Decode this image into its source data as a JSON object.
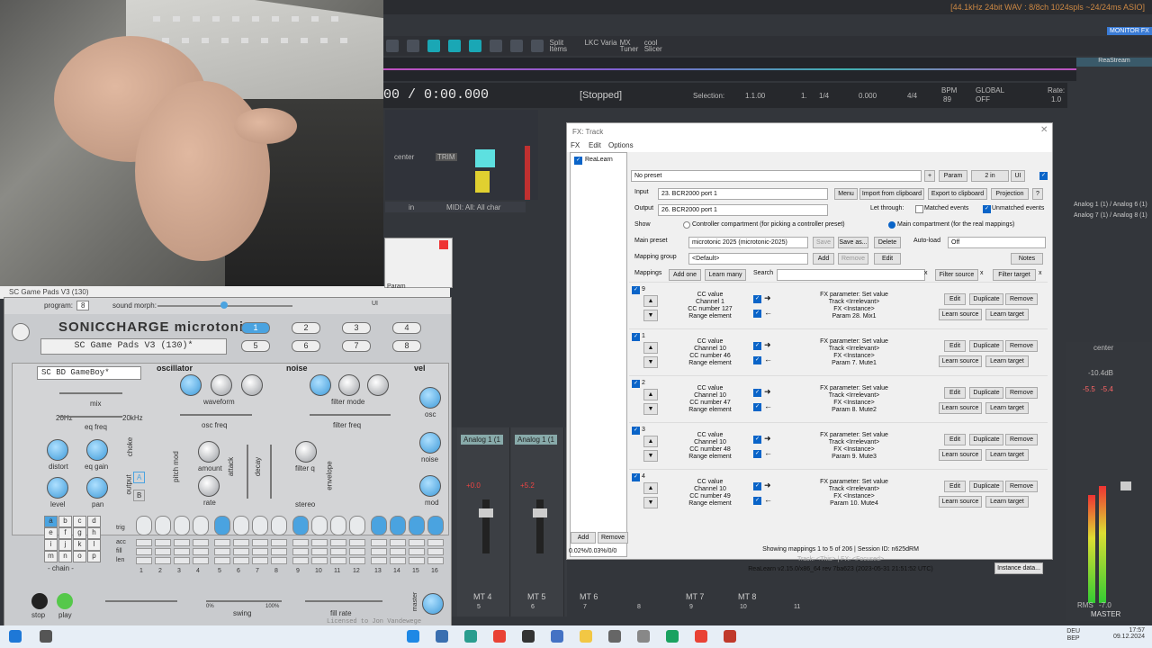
{
  "reaper": {
    "format_info": "[44.1kHz 24bit WAV : 8/8ch 1024spls ~24/24ms ASIO]",
    "monitor": "MONITOR FX",
    "toolbar": {
      "split_items": "Split Items",
      "lkc_varia": "LKC Varia",
      "mx_tuner": "MX Tuner",
      "cool_slicer": "cool Slicer",
      "mx_tuner2": "MX Tuner",
      "cool_slicer2": "cool Slicer"
    },
    "time": "00 / 0:00.000",
    "status": "[Stopped]",
    "selection_label": "Selection:",
    "selection_start": "1.1.00",
    "selection_end": "1.",
    "time_sig1": "1/4",
    "selection_len": "0.000",
    "time_sig2": "4/4",
    "bpm_label": "BPM",
    "bpm": "89",
    "global": "GLOBAL",
    "off": "OFF",
    "rate_label": "Rate:",
    "rate": "1.0",
    "reastream": "ReaStream",
    "track_center": "center",
    "trim": "TRIM",
    "midi_label": "MIDI: All: All char",
    "in": "in",
    "analog_out": [
      "Analog 1 (1) / Analog 6 (1)",
      "Analog 7 (1) / Analog 8 (1)"
    ],
    "strips": [
      {
        "name": "Analog 1 (1",
        "db": "+0.0"
      },
      {
        "name": "Analog 1 (1",
        "db": "+5.2"
      }
    ],
    "master": {
      "label": "MASTER",
      "center": "center",
      "db": "-10.4dB",
      "peak_l": "-5.5",
      "peak_r": "-5.4",
      "rms": "RMS",
      "rms_val": "-7.0"
    },
    "track_labels": [
      "MT 4",
      "MT 5",
      "MT 6",
      "MT 7",
      "MT 8"
    ],
    "track_numbers": [
      "5",
      "6",
      "7",
      "8",
      "9",
      "10",
      "11"
    ]
  },
  "microtonic": {
    "header_preset": "SC Game Pads V3 (130)",
    "program_label": "program:",
    "program_value": "8",
    "sound_morph": "sound morph:",
    "param": "Param",
    "io": "1 out",
    "ui": "UI",
    "brand": "SONICCHARGE microtonic",
    "preset": "SC Game Pads V3 (130)*",
    "patterns": [
      "1",
      "2",
      "3",
      "4",
      "5",
      "6",
      "7",
      "8"
    ],
    "drum_name": "SC BD GameBoy*",
    "sections": {
      "osc": "oscillator",
      "noise": "noise",
      "vel": "vel"
    },
    "labels": {
      "mix": "mix",
      "eq_freq": "eq freq",
      "distort": "distort",
      "eq_gain": "eq gain",
      "level": "level",
      "pan": "pan",
      "waveform": "waveform",
      "osc_freq": "osc freq",
      "pitch_mod": "pitch mod",
      "amount": "amount",
      "rate": "rate",
      "attack": "attack",
      "decay": "decay",
      "filter_mode": "filter mode",
      "filter_freq": "filter freq",
      "filter_q": "filter q",
      "stereo": "stereo",
      "envelope": "envelope",
      "osc": "osc",
      "noise": "noise",
      "mod": "mod",
      "choke": "choke",
      "output": "output",
      "hz20": "20Hz",
      "hz20k": "20kHz"
    },
    "choke_value": "B",
    "output_value": "A",
    "letters": [
      "a",
      "b",
      "c",
      "d",
      "e",
      "f",
      "g",
      "h",
      "i",
      "j",
      "k",
      "l",
      "m",
      "n",
      "o",
      "p"
    ],
    "chain": "- chain -",
    "step_labels": [
      "trig",
      "acc",
      "fill",
      "len"
    ],
    "step_numbers": [
      "1",
      "2",
      "3",
      "4",
      "5",
      "6",
      "7",
      "8",
      "9",
      "10",
      "11",
      "12",
      "13",
      "14",
      "15",
      "16"
    ],
    "steps_on": [
      0,
      0,
      0,
      0,
      1,
      0,
      0,
      0,
      1,
      0,
      0,
      0,
      1,
      1,
      1,
      1
    ],
    "stop": "stop",
    "play": "play",
    "swing": "swing",
    "fill_rate": "fill rate",
    "master": "master",
    "swing_pct0": "0%",
    "swing_pct100": "100%",
    "licensed": "Licensed to Jon Vandewege"
  },
  "fx": {
    "title": "FX: Track",
    "menu": [
      "FX",
      "Edit",
      "Options"
    ],
    "plugin": "ReaLearn",
    "preset": "No preset",
    "param": "Param",
    "io": "2 in",
    "ui": "UI",
    "input_label": "Input",
    "input_value": "23. BCR2000 port 1",
    "output_label": "Output",
    "output_value": "26. BCR2000 port 1",
    "menu_btn": "Menu",
    "import": "Import from clipboard",
    "export": "Export to clipboard",
    "projection": "Projection",
    "help": "?",
    "let_through": "Let through:",
    "matched": "Matched events",
    "unmatched": "Unmatched events",
    "show_label": "Show",
    "controller_comp": "Controller compartment (for picking a controller preset)",
    "main_comp": "Main compartment (for the real mappings)",
    "main_preset_label": "Main preset",
    "main_preset": "microtonic 2025 (microtonic-2025)",
    "save": "Save",
    "save_as": "Save as...",
    "delete": "Delete",
    "auto_load": "Auto-load",
    "auto_load_value": "Off",
    "mapping_group_label": "Mapping group",
    "mapping_group": "<Default>",
    "add": "Add",
    "remove": "Remove",
    "edit": "Edit",
    "notes": "Notes",
    "mappings_label": "Mappings",
    "add_one": "Add one",
    "learn_many": "Learn many",
    "search": "Search",
    "x": "x",
    "filter_source": "Filter source",
    "filter_target": "Filter target",
    "mappings": [
      {
        "name": "9",
        "src": [
          "CC value",
          "Channel 1",
          "CC number 127",
          "Range element"
        ],
        "tgt": [
          "FX parameter: Set value",
          "Track <Irrelevant>",
          "FX <Instance>",
          "Param 28. Mix1"
        ]
      },
      {
        "name": "1",
        "src": [
          "CC value",
          "Channel 10",
          "CC number 46",
          "Range element"
        ],
        "tgt": [
          "FX parameter: Set value",
          "Track <Irrelevant>",
          "FX <Instance>",
          "Param 7. Mute1"
        ]
      },
      {
        "name": "2",
        "src": [
          "CC value",
          "Channel 10",
          "CC number 47",
          "Range element"
        ],
        "tgt": [
          "FX parameter: Set value",
          "Track <Irrelevant>",
          "FX <Instance>",
          "Param 8. Mute2"
        ]
      },
      {
        "name": "3",
        "src": [
          "CC value",
          "Channel 10",
          "CC number 48",
          "Range element"
        ],
        "tgt": [
          "FX parameter: Set value",
          "Track <Irrelevant>",
          "FX <Instance>",
          "Param 9. Mute3"
        ]
      },
      {
        "name": "4",
        "src": [
          "CC value",
          "Channel 10",
          "CC number 49",
          "Range element"
        ],
        "tgt": [
          "FX parameter: Set value",
          "Track <Irrelevant>",
          "FX <Instance>",
          "Param 10. Mute4"
        ]
      }
    ],
    "row_edit": "Edit",
    "row_duplicate": "Duplicate",
    "row_remove": "Remove",
    "row_learn_source": "Learn source",
    "row_learn_target": "Learn target",
    "showing": "Showing mappings 1 to 5 of 206 | Session ID: n625dRM",
    "track_this": "Track: <This> | FX: <Focused>",
    "version": "ReaLearn v2.15.0/x86_64 rev 7ba623 (2023-05-31 21:51:52 UTC)",
    "instance_data": "Instance data...",
    "footer_add": "Add",
    "footer_remove": "Remove",
    "cpu": "0.02%/0.03%/0/0"
  },
  "taskbar": {
    "lang": "DEU",
    "lang2": "BEP",
    "time": "17:57",
    "date": "09.12.2024"
  }
}
